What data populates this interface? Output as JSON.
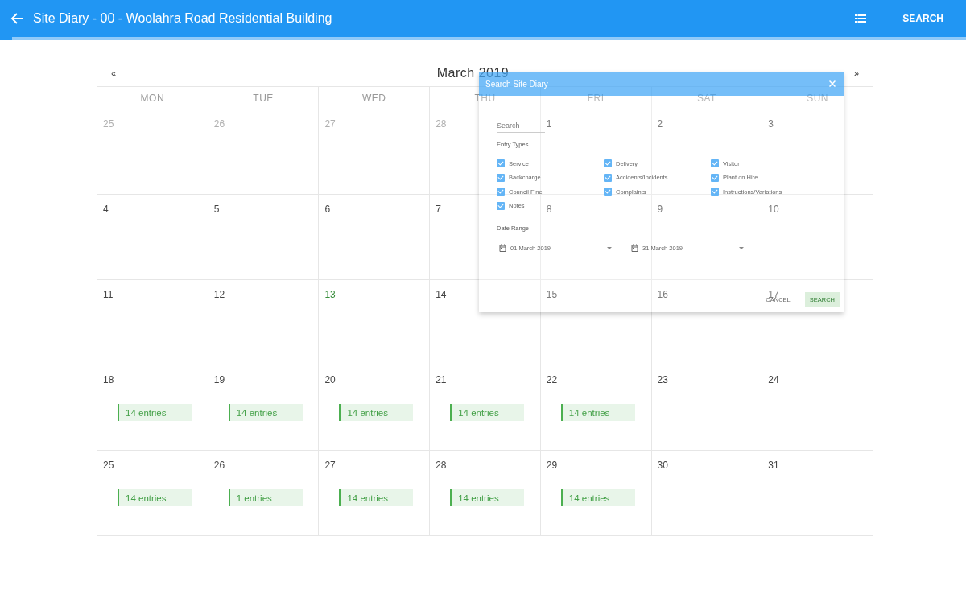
{
  "app_bar": {
    "title": "Site Diary - 00 - Woolahra Road Residential Building",
    "action": "SEARCH"
  },
  "calendar": {
    "prev": "«",
    "month": "March 2019",
    "next": "»",
    "weekdays": [
      "MON",
      "TUE",
      "WED",
      "THU",
      "FRI",
      "SAT",
      "SUN"
    ],
    "weeks": [
      [
        {
          "day": "25",
          "muted": true
        },
        {
          "day": "26",
          "muted": true
        },
        {
          "day": "27",
          "muted": true
        },
        {
          "day": "28",
          "muted": true
        },
        {
          "day": "1",
          "muted": false
        },
        {
          "day": "2",
          "muted": false
        },
        {
          "day": "3",
          "muted": false
        }
      ],
      [
        {
          "day": "4",
          "muted": false
        },
        {
          "day": "5",
          "muted": false
        },
        {
          "day": "6",
          "muted": false
        },
        {
          "day": "7",
          "muted": false
        },
        {
          "day": "8",
          "muted": false
        },
        {
          "day": "9",
          "muted": false
        },
        {
          "day": "10",
          "muted": false
        }
      ],
      [
        {
          "day": "11",
          "muted": false
        },
        {
          "day": "12",
          "muted": false
        },
        {
          "day": "13",
          "muted": false,
          "today": true
        },
        {
          "day": "14",
          "muted": false
        },
        {
          "day": "15",
          "muted": false
        },
        {
          "day": "16",
          "muted": false
        },
        {
          "day": "17",
          "muted": false
        }
      ],
      [
        {
          "day": "18",
          "muted": false,
          "entries": "14 entries"
        },
        {
          "day": "19",
          "muted": false,
          "entries": "14 entries"
        },
        {
          "day": "20",
          "muted": false,
          "entries": "14 entries"
        },
        {
          "day": "21",
          "muted": false,
          "entries": "14 entries"
        },
        {
          "day": "22",
          "muted": false,
          "entries": "14 entries"
        },
        {
          "day": "23",
          "muted": false
        },
        {
          "day": "24",
          "muted": false
        }
      ],
      [
        {
          "day": "25",
          "muted": false,
          "entries": "14 entries"
        },
        {
          "day": "26",
          "muted": false,
          "entries": "1 entries"
        },
        {
          "day": "27",
          "muted": false,
          "entries": "14 entries"
        },
        {
          "day": "28",
          "muted": false,
          "entries": "14 entries"
        },
        {
          "day": "29",
          "muted": false,
          "entries": "14 entries"
        },
        {
          "day": "30",
          "muted": false
        },
        {
          "day": "31",
          "muted": false
        }
      ]
    ]
  },
  "dialog": {
    "title": "Search Site Diary",
    "search_placeholder": "Search",
    "entry_types_label": "Entry Types",
    "entry_types": [
      {
        "label": "Service",
        "checked": true
      },
      {
        "label": "Delivery",
        "checked": true
      },
      {
        "label": "Visitor",
        "checked": true
      },
      {
        "label": "Backcharge",
        "checked": true
      },
      {
        "label": "Accidents/Incidents",
        "checked": true
      },
      {
        "label": "Plant on Hire",
        "checked": true
      },
      {
        "label": "Council Fine",
        "checked": true
      },
      {
        "label": "Complaints",
        "checked": true
      },
      {
        "label": "Instructions/Variations",
        "checked": true
      },
      {
        "label": "Notes",
        "checked": true
      }
    ],
    "date_range_label": "Date Range",
    "date_from": "01 March 2019",
    "date_to": "31 March 2019",
    "buttons": [
      {
        "label": "CANCEL",
        "kind": "text"
      },
      {
        "label": "SEARCH",
        "kind": "primary"
      }
    ]
  }
}
